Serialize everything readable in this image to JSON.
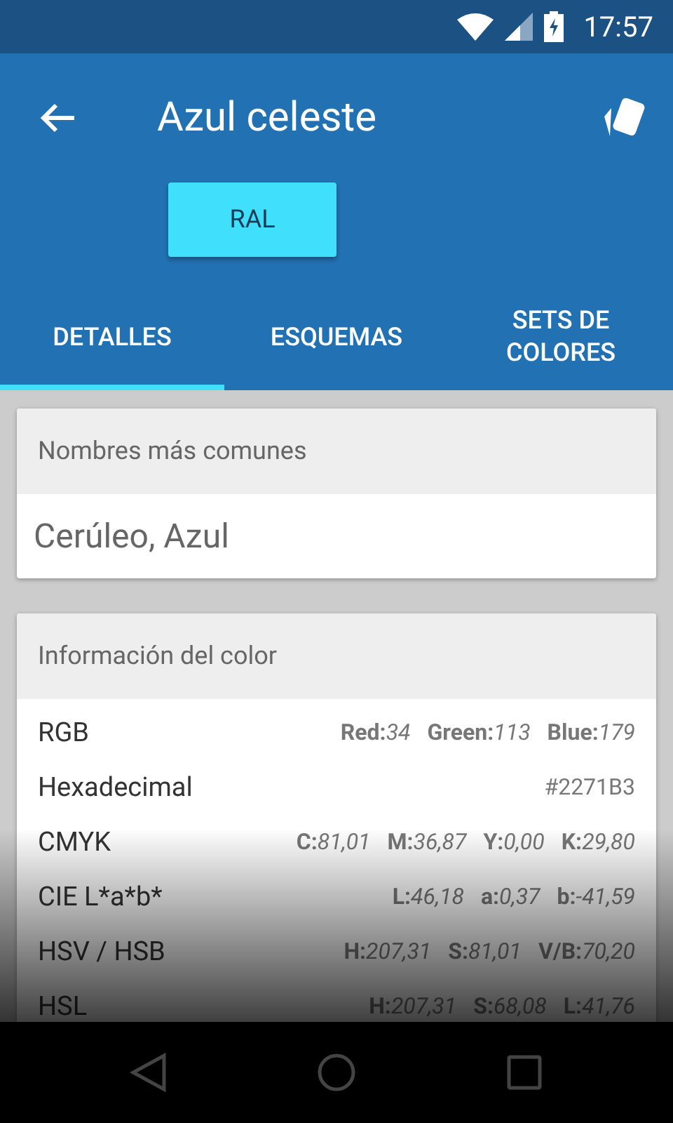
{
  "status_bar": {
    "time": "17:57"
  },
  "app_bar": {
    "title": "Azul celeste",
    "button": "RAL"
  },
  "tabs": [
    {
      "label": "DETALLES",
      "selected": true
    },
    {
      "label": "ESQUEMAS",
      "selected": false
    },
    {
      "label": "SETS DE COLORES",
      "selected": false
    }
  ],
  "names_card": {
    "title": "Nombres más comunes",
    "value": "Cerúleo, Azul"
  },
  "info_card": {
    "title": "Información del color",
    "rows": [
      {
        "label": "RGB",
        "parts": [
          {
            "label": "Red:",
            "value": "34"
          },
          {
            "label": "Green:",
            "value": "113"
          },
          {
            "label": "Blue:",
            "value": "179"
          }
        ]
      },
      {
        "label": "Hexadecimal",
        "parts": [
          {
            "value": "#2271B3"
          }
        ]
      },
      {
        "label": "CMYK",
        "parts": [
          {
            "label": "C:",
            "value": "81,01"
          },
          {
            "label": "M:",
            "value": "36,87"
          },
          {
            "label": "Y:",
            "value": "0,00"
          },
          {
            "label": "K:",
            "value": "29,80"
          }
        ]
      },
      {
        "label": "CIE L*a*b*",
        "parts": [
          {
            "label": "L:",
            "value": "46,18"
          },
          {
            "label": "a:",
            "value": "0,37"
          },
          {
            "label": "b:",
            "value": "-41,59"
          }
        ]
      },
      {
        "label": "HSV / HSB",
        "parts": [
          {
            "label": "H:",
            "value": "207,31"
          },
          {
            "label": "S:",
            "value": "81,01"
          },
          {
            "label": "V/B:",
            "value": "70,20"
          }
        ]
      },
      {
        "label": "HSL",
        "parts": [
          {
            "label": "H:",
            "value": "207,31"
          },
          {
            "label": "S:",
            "value": "68,08"
          },
          {
            "label": "L:",
            "value": "41,76"
          }
        ]
      }
    ]
  }
}
